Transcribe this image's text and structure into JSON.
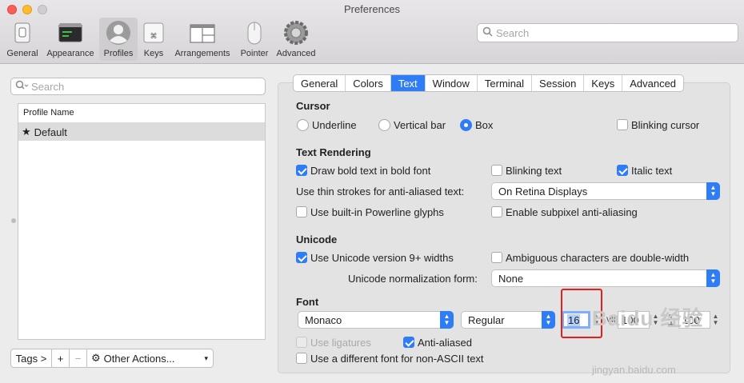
{
  "window": {
    "title": "Preferences"
  },
  "toolbar": {
    "items": [
      {
        "label": "General",
        "icon": "switch-icon"
      },
      {
        "label": "Appearance",
        "icon": "appearance-icon"
      },
      {
        "label": "Profiles",
        "icon": "user-icon",
        "active": true
      },
      {
        "label": "Keys",
        "icon": "keyboard-icon"
      },
      {
        "label": "Arrangements",
        "icon": "window-arrangement-icon"
      },
      {
        "label": "Pointer",
        "icon": "mouse-icon"
      },
      {
        "label": "Advanced",
        "icon": "gear-icon"
      }
    ],
    "search_placeholder": "Search"
  },
  "profiles": {
    "search_placeholder": "Search",
    "column_header": "Profile Name",
    "items": [
      {
        "name": "Default",
        "icon": "star-icon",
        "selected": true
      }
    ],
    "tags_label": "Tags >",
    "add_label": "+",
    "remove_label": "−",
    "other_actions_label": "Other Actions..."
  },
  "tabs": [
    "General",
    "Colors",
    "Text",
    "Window",
    "Terminal",
    "Session",
    "Keys",
    "Advanced"
  ],
  "active_tab": "Text",
  "cursor": {
    "heading": "Cursor",
    "options": [
      "Underline",
      "Vertical bar",
      "Box"
    ],
    "selected": "Box",
    "blinking_label": "Blinking cursor",
    "blinking": false
  },
  "text_rendering": {
    "heading": "Text Rendering",
    "bold_label": "Draw bold text in bold font",
    "bold": true,
    "blinking_text_label": "Blinking text",
    "blinking_text": false,
    "italic_label": "Italic text",
    "italic": true,
    "thin_strokes_label": "Use thin strokes for anti-aliased text:",
    "thin_strokes_value": "On Retina Displays",
    "powerline_label": "Use built-in Powerline glyphs",
    "powerline": false,
    "subpixel_label": "Enable subpixel anti-aliasing",
    "subpixel": false
  },
  "unicode": {
    "heading": "Unicode",
    "version_label": "Use Unicode version 9+ widths",
    "version": true,
    "ambiguous_label": "Ambiguous characters are double-width",
    "ambiguous": false,
    "normalization_label": "Unicode normalization form:",
    "normalization_value": "None"
  },
  "font": {
    "heading": "Font",
    "family": "Monaco",
    "style": "Regular",
    "size": "16",
    "vertical_spacing_icon": "vertical-spacing-icon",
    "vertical_spacing_label": "vli",
    "vertical_spacing": "100",
    "horizontal_spacing_icon": "horizontal-spacing-icon",
    "horizontal_spacing": "100",
    "ligatures_label": "Use ligatures",
    "ligatures": false,
    "anti_aliased_label": "Anti-aliased",
    "anti_aliased": true,
    "non_ascii_label": "Use a different font for non-ASCII text",
    "non_ascii": false
  },
  "watermark": {
    "text": "Baidu 经验",
    "url": "jingyan.baidu.com"
  },
  "colors": {
    "accent": "#2e7cf6",
    "annotation": "#e41f1f"
  }
}
